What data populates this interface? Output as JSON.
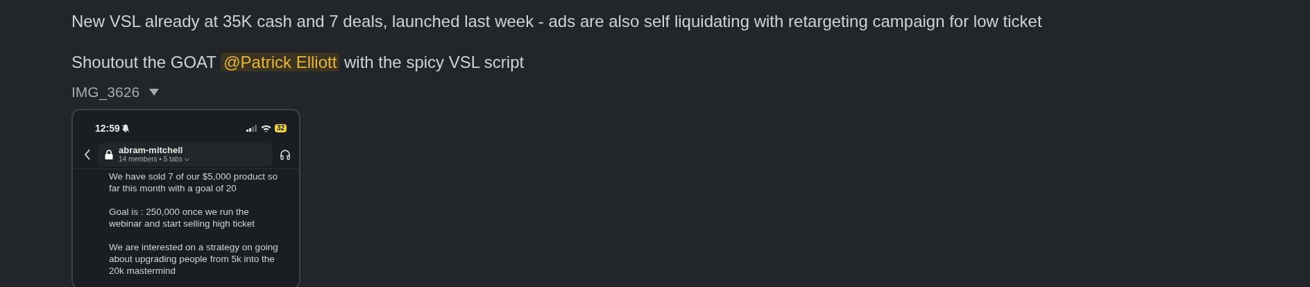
{
  "message": {
    "line_1": "New VSL already at 35K cash and 7 deals, launched last week - ads are also self liquidating with retargeting campaign for low ticket",
    "line_2": {
      "before": "Shoutout the GOAT",
      "mention": "@Patrick Elliott",
      "after": "with the spicy VSL script"
    }
  },
  "attachment": {
    "name": "IMG_3626",
    "expanded": true,
    "screenshot": {
      "status_bar": {
        "time": "12:59",
        "battery": "32"
      },
      "channel": {
        "name": "abram-mitchell",
        "meta": "14 members • 5 tabs"
      },
      "paragraphs": [
        [
          "We have sold 7 of our $5,000 product so",
          "far this month with a goal of 20"
        ],
        [
          "Goal is : 250,000 once we run the",
          "webinar and start selling high ticket"
        ],
        [
          "We are interested on a strategy on going",
          "about upgrading people from 5k into the",
          "20k mastermind"
        ]
      ]
    }
  }
}
